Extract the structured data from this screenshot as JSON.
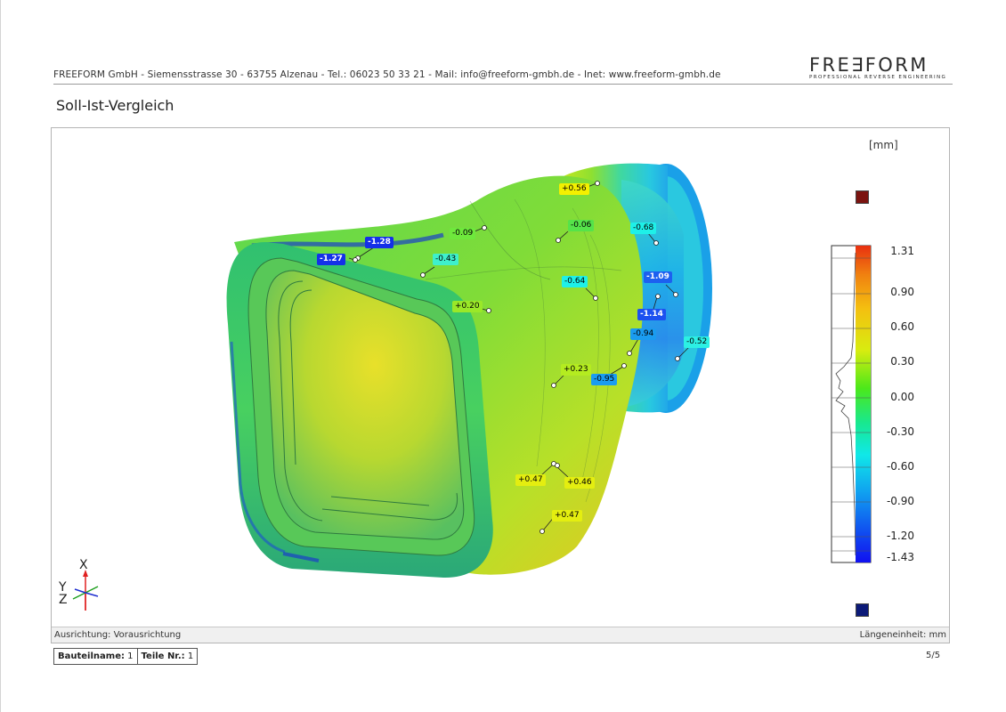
{
  "header": {
    "contact_line": "FREEFORM GmbH - Siemensstrasse 30 - 63755 Alzenau - Tel.: 06023 50 33 21 - Mail: info@freeform-gmbh.de - Inet: www.freeform-gmbh.de",
    "logo_text": "FRE∃FORM",
    "logo_tagline": "Professional Reverse Engineering"
  },
  "title": "Soll-Ist-Vergleich",
  "colorbar": {
    "unit": "[mm]",
    "ticks": [
      "1.31",
      "0.90",
      "0.60",
      "0.30",
      "0.00",
      "-0.30",
      "-0.60",
      "-0.90",
      "-1.20",
      "-1.43"
    ],
    "over_color": "#7b1410",
    "under_color": "#0c1a78"
  },
  "callouts": [
    {
      "label": "+0.56",
      "color": "#f4f000"
    },
    {
      "label": "-0.09",
      "color": "#6ee83c"
    },
    {
      "label": "-0.06",
      "color": "#55e34a"
    },
    {
      "label": "-0.68",
      "color": "#1ef0e8"
    },
    {
      "label": "-1.28",
      "color": "#1430e8"
    },
    {
      "label": "-1.27",
      "color": "#1430e8"
    },
    {
      "label": "-0.43",
      "color": "#3ef0cc"
    },
    {
      "label": "-0.64",
      "color": "#1ef0e8"
    },
    {
      "label": "-1.09",
      "color": "#1c60f0"
    },
    {
      "label": "+0.20",
      "color": "#9ae828"
    },
    {
      "label": "-1.14",
      "color": "#1c50f0"
    },
    {
      "label": "-0.94",
      "color": "#1a9cf0"
    },
    {
      "label": "-0.52",
      "color": "#2cf0e4"
    },
    {
      "label": "+0.23",
      "color": "#b4ec20"
    },
    {
      "label": "-0.95",
      "color": "#1a9cf0"
    },
    {
      "label": "+0.47",
      "color": "#e4ee10"
    },
    {
      "label": "+0.46",
      "color": "#e4ee10"
    },
    {
      "label": "+0.47",
      "color": "#e4ee10"
    }
  ],
  "triad": {
    "x": "X",
    "y": "Y",
    "z": "Z"
  },
  "footer": {
    "alignment": "Ausrichtung: Vorausrichtung",
    "length_unit": "Längeneinheit: mm"
  },
  "part_info": {
    "name_label": "Bauteilname:",
    "name_value": "1",
    "part_no_label": "Teile Nr.:",
    "part_no_value": "1"
  },
  "page_number": "5/5",
  "icons": [
    "coordinate-triad-icon",
    "company-logo"
  ]
}
